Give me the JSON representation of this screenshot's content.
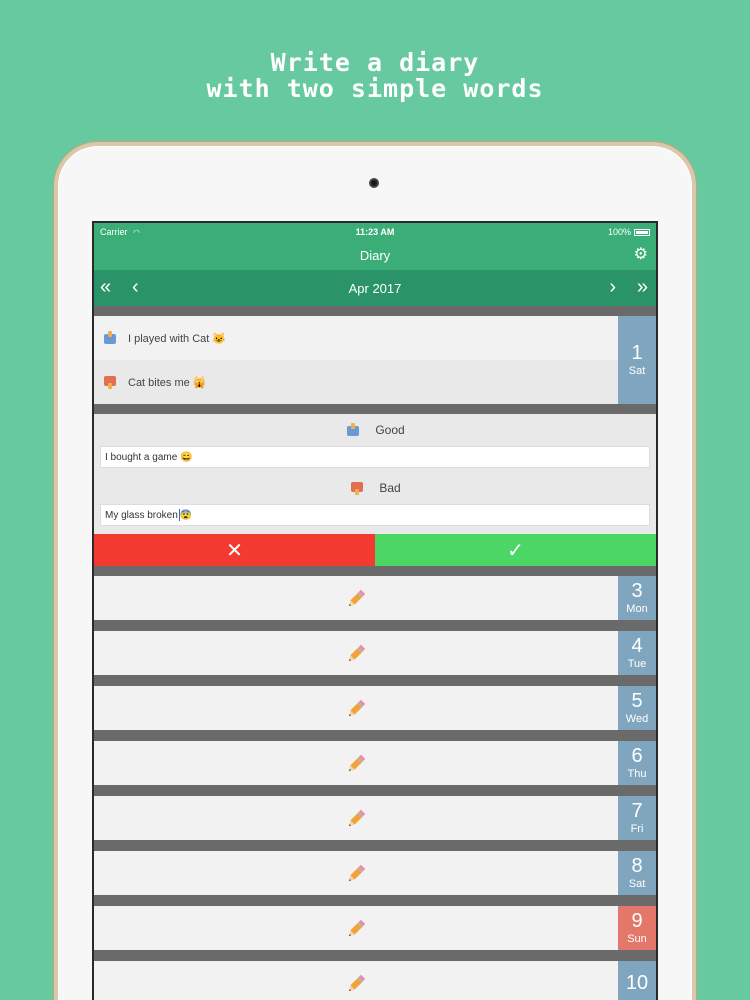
{
  "headline": {
    "line1": "Write a diary",
    "line2": "with two simple words"
  },
  "status_bar": {
    "carrier": "Carrier",
    "time": "11:23 AM",
    "battery": "100%"
  },
  "nav": {
    "title": "Diary",
    "settings_icon": "gear-icon"
  },
  "month_bar": {
    "label": "Apr 2017",
    "first_icon": "double-chevron-left-icon",
    "prev_icon": "chevron-left-icon",
    "next_icon": "chevron-right-icon",
    "last_icon": "double-chevron-right-icon"
  },
  "day1": {
    "good": "I played with Cat 😺",
    "bad": "Cat bites me 🙀",
    "num": "1",
    "weekday": "Sat"
  },
  "editor": {
    "good_label": "Good",
    "good_value": "I bought a game 😄",
    "bad_label": "Bad",
    "bad_value": "My glass broken",
    "bad_emoji": "😨",
    "cancel": "✕",
    "confirm": "✓"
  },
  "days": [
    {
      "num": "3",
      "weekday": "Mon",
      "color": "#7FA6BE"
    },
    {
      "num": "4",
      "weekday": "Tue",
      "color": "#7FA6BE"
    },
    {
      "num": "5",
      "weekday": "Wed",
      "color": "#7FA6BE"
    },
    {
      "num": "6",
      "weekday": "Thu",
      "color": "#7FA6BE"
    },
    {
      "num": "7",
      "weekday": "Fri",
      "color": "#7FA6BE"
    },
    {
      "num": "8",
      "weekday": "Sat",
      "color": "#7FA6BE"
    },
    {
      "num": "9",
      "weekday": "Sun",
      "color": "#E2776A"
    },
    {
      "num": "10",
      "weekday": "",
      "color": "#7FA6BE"
    }
  ],
  "colors": {
    "background": "#66C9A0",
    "header": "#3BAE78",
    "month_bar": "#2A9468",
    "cancel": "#F23A30",
    "confirm": "#4CD666"
  }
}
